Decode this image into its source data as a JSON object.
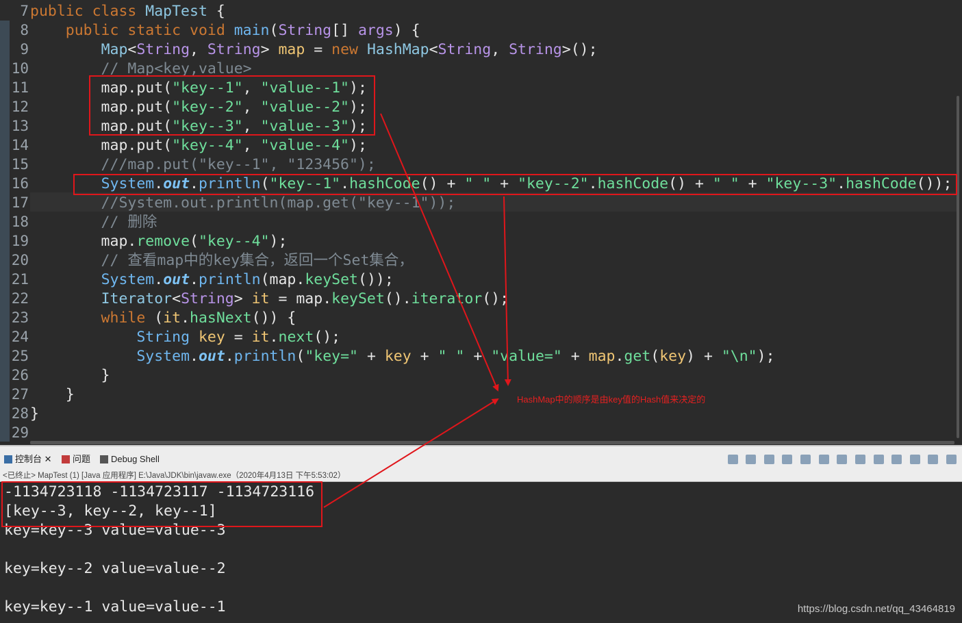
{
  "editor": {
    "lines": [
      {
        "n": "7",
        "tokens": [
          {
            "t": "public class ",
            "c": "kw"
          },
          {
            "t": "MapTest",
            "c": "cls"
          },
          {
            "t": " {",
            "c": "sy"
          }
        ]
      },
      {
        "n": "8",
        "tokens": [
          {
            "t": "    public static void ",
            "c": "kw"
          },
          {
            "t": "main",
            "c": "fn"
          },
          {
            "t": "(",
            "c": "sy"
          },
          {
            "t": "String",
            "c": "ty"
          },
          {
            "t": "[] ",
            "c": "sy"
          },
          {
            "t": "args",
            "c": "ty"
          },
          {
            "t": ") {",
            "c": "sy"
          }
        ]
      },
      {
        "n": "9",
        "tokens": [
          {
            "t": "        ",
            "c": "sy"
          },
          {
            "t": "Map",
            "c": "cls"
          },
          {
            "t": "<",
            "c": "sy"
          },
          {
            "t": "String",
            "c": "ty"
          },
          {
            "t": ", ",
            "c": "sy"
          },
          {
            "t": "String",
            "c": "ty"
          },
          {
            "t": "> ",
            "c": "sy"
          },
          {
            "t": "map",
            "c": "var"
          },
          {
            "t": " = ",
            "c": "sy"
          },
          {
            "t": "new ",
            "c": "kw"
          },
          {
            "t": "HashMap",
            "c": "cls"
          },
          {
            "t": "<",
            "c": "sy"
          },
          {
            "t": "String",
            "c": "ty"
          },
          {
            "t": ", ",
            "c": "sy"
          },
          {
            "t": "String",
            "c": "ty"
          },
          {
            "t": ">();",
            "c": "sy"
          }
        ]
      },
      {
        "n": "10",
        "tokens": [
          {
            "t": "        // Map<key,value>",
            "c": "cm"
          }
        ]
      },
      {
        "n": "11",
        "tokens": [
          {
            "t": "        map.put(",
            "c": "sy"
          },
          {
            "t": "\"key--1\"",
            "c": "str"
          },
          {
            "t": ", ",
            "c": "sy"
          },
          {
            "t": "\"value--1\"",
            "c": "str"
          },
          {
            "t": ");",
            "c": "sy"
          }
        ]
      },
      {
        "n": "12",
        "tokens": [
          {
            "t": "        map.put(",
            "c": "sy"
          },
          {
            "t": "\"key--2\"",
            "c": "str"
          },
          {
            "t": ", ",
            "c": "sy"
          },
          {
            "t": "\"value--2\"",
            "c": "str"
          },
          {
            "t": ");",
            "c": "sy"
          }
        ]
      },
      {
        "n": "13",
        "tokens": [
          {
            "t": "        map.put(",
            "c": "sy"
          },
          {
            "t": "\"key--3\"",
            "c": "str"
          },
          {
            "t": ", ",
            "c": "sy"
          },
          {
            "t": "\"value--3\"",
            "c": "str"
          },
          {
            "t": ");",
            "c": "sy"
          }
        ]
      },
      {
        "n": "14",
        "tokens": [
          {
            "t": "        map.put(",
            "c": "sy"
          },
          {
            "t": "\"key--4\"",
            "c": "str"
          },
          {
            "t": ", ",
            "c": "sy"
          },
          {
            "t": "\"value--4\"",
            "c": "str"
          },
          {
            "t": ");",
            "c": "sy"
          }
        ]
      },
      {
        "n": "15",
        "tokens": [
          {
            "t": "        ///map.put(\"key--1\", \"123456\");",
            "c": "cm"
          }
        ]
      },
      {
        "n": "16",
        "tokens": [
          {
            "t": "        ",
            "c": "sy"
          },
          {
            "t": "System",
            "c": "fn"
          },
          {
            "t": ".",
            "c": "sy"
          },
          {
            "t": "out",
            "c": "st"
          },
          {
            "t": ".",
            "c": "sy"
          },
          {
            "t": "println",
            "c": "fn"
          },
          {
            "t": "(",
            "c": "sy"
          },
          {
            "t": "\"key--1\"",
            "c": "str"
          },
          {
            "t": ".",
            "c": "sy"
          },
          {
            "t": "hashCode",
            "c": "str"
          },
          {
            "t": "() + ",
            "c": "sy"
          },
          {
            "t": "\" \"",
            "c": "str"
          },
          {
            "t": " + ",
            "c": "sy"
          },
          {
            "t": "\"key--2\"",
            "c": "str"
          },
          {
            "t": ".",
            "c": "sy"
          },
          {
            "t": "hashCode",
            "c": "str"
          },
          {
            "t": "() + ",
            "c": "sy"
          },
          {
            "t": "\" \"",
            "c": "str"
          },
          {
            "t": " + ",
            "c": "sy"
          },
          {
            "t": "\"key--3\"",
            "c": "str"
          },
          {
            "t": ".",
            "c": "sy"
          },
          {
            "t": "hashCode",
            "c": "str"
          },
          {
            "t": "());",
            "c": "sy"
          }
        ]
      },
      {
        "n": "17",
        "tokens": [
          {
            "t": "        //System.out.println(map.get(\"key--1\"));",
            "c": "cm"
          }
        ]
      },
      {
        "n": "18",
        "tokens": [
          {
            "t": "        // 删除",
            "c": "cm"
          }
        ]
      },
      {
        "n": "19",
        "tokens": [
          {
            "t": "        map.",
            "c": "sy"
          },
          {
            "t": "remove",
            "c": "str"
          },
          {
            "t": "(",
            "c": "sy"
          },
          {
            "t": "\"key--4\"",
            "c": "str"
          },
          {
            "t": ");",
            "c": "sy"
          }
        ]
      },
      {
        "n": "20",
        "tokens": [
          {
            "t": "        // 查看map中的key集合，返回一个Set集合，",
            "c": "cm"
          }
        ]
      },
      {
        "n": "21",
        "tokens": [
          {
            "t": "        ",
            "c": "sy"
          },
          {
            "t": "System",
            "c": "fn"
          },
          {
            "t": ".",
            "c": "sy"
          },
          {
            "t": "out",
            "c": "st"
          },
          {
            "t": ".",
            "c": "sy"
          },
          {
            "t": "println",
            "c": "fn"
          },
          {
            "t": "(map.",
            "c": "sy"
          },
          {
            "t": "keySet",
            "c": "str"
          },
          {
            "t": "());",
            "c": "sy"
          }
        ]
      },
      {
        "n": "22",
        "tokens": [
          {
            "t": "        ",
            "c": "sy"
          },
          {
            "t": "Iterator",
            "c": "cls"
          },
          {
            "t": "<",
            "c": "sy"
          },
          {
            "t": "String",
            "c": "ty"
          },
          {
            "t": "> ",
            "c": "sy"
          },
          {
            "t": "it",
            "c": "var"
          },
          {
            "t": " = map.",
            "c": "sy"
          },
          {
            "t": "keySet",
            "c": "str"
          },
          {
            "t": "().",
            "c": "sy"
          },
          {
            "t": "iterator",
            "c": "str"
          },
          {
            "t": "();",
            "c": "sy"
          }
        ]
      },
      {
        "n": "23",
        "tokens": [
          {
            "t": "        while ",
            "c": "kw"
          },
          {
            "t": "(",
            "c": "sy"
          },
          {
            "t": "it",
            "c": "var"
          },
          {
            "t": ".",
            "c": "sy"
          },
          {
            "t": "hasNext",
            "c": "str"
          },
          {
            "t": "()) {",
            "c": "sy"
          }
        ]
      },
      {
        "n": "24",
        "tokens": [
          {
            "t": "            ",
            "c": "sy"
          },
          {
            "t": "String",
            "c": "fn"
          },
          {
            "t": " ",
            "c": "sy"
          },
          {
            "t": "key",
            "c": "var"
          },
          {
            "t": " = ",
            "c": "sy"
          },
          {
            "t": "it",
            "c": "var"
          },
          {
            "t": ".",
            "c": "sy"
          },
          {
            "t": "next",
            "c": "str"
          },
          {
            "t": "();",
            "c": "sy"
          }
        ]
      },
      {
        "n": "25",
        "tokens": [
          {
            "t": "            ",
            "c": "sy"
          },
          {
            "t": "System",
            "c": "fn"
          },
          {
            "t": ".",
            "c": "sy"
          },
          {
            "t": "out",
            "c": "st"
          },
          {
            "t": ".",
            "c": "sy"
          },
          {
            "t": "println",
            "c": "fn"
          },
          {
            "t": "(",
            "c": "sy"
          },
          {
            "t": "\"key=\"",
            "c": "str"
          },
          {
            "t": " + ",
            "c": "sy"
          },
          {
            "t": "key",
            "c": "var"
          },
          {
            "t": " + ",
            "c": "sy"
          },
          {
            "t": "\" \"",
            "c": "str"
          },
          {
            "t": " + ",
            "c": "sy"
          },
          {
            "t": "\"value=\"",
            "c": "str"
          },
          {
            "t": " + ",
            "c": "sy"
          },
          {
            "t": "map",
            "c": "var"
          },
          {
            "t": ".",
            "c": "sy"
          },
          {
            "t": "get",
            "c": "str"
          },
          {
            "t": "(",
            "c": "sy"
          },
          {
            "t": "key",
            "c": "var"
          },
          {
            "t": ") + ",
            "c": "sy"
          },
          {
            "t": "\"\\n\"",
            "c": "str"
          },
          {
            "t": ");",
            "c": "sy"
          }
        ]
      },
      {
        "n": "26",
        "tokens": [
          {
            "t": "        }",
            "c": "sy"
          }
        ]
      },
      {
        "n": "27",
        "tokens": [
          {
            "t": "    }",
            "c": "sy"
          }
        ]
      },
      {
        "n": "28",
        "tokens": [
          {
            "t": "}",
            "c": "sy"
          }
        ]
      },
      {
        "n": "29",
        "tokens": []
      }
    ]
  },
  "console": {
    "tabs": [
      {
        "label": "控制台 ✕",
        "icon": "console-icon",
        "color": "#3a6ea5"
      },
      {
        "label": "问题",
        "icon": "problems-icon",
        "color": "#c23b3b"
      },
      {
        "label": "Debug Shell",
        "icon": "debug-shell-icon",
        "color": "#555555"
      }
    ],
    "status": "<已终止> MapTest (1)  [Java 应用程序] E:\\Java\\JDK\\bin\\javaw.exe（2020年4月13日 下午5:53:02）",
    "output": [
      "-1134723118 -1134723117 -1134723116",
      "[key--3, key--2, key--1]",
      "key=key--3 value=value--3",
      "",
      "key=key--2 value=value--2",
      "",
      "key=key--1 value=value--1"
    ]
  },
  "annotation": {
    "note": "HashMap中的顺序是由key值的Hash值来决定的",
    "color": "#e0161b"
  },
  "watermark": "https://blog.csdn.net/qq_43464819"
}
